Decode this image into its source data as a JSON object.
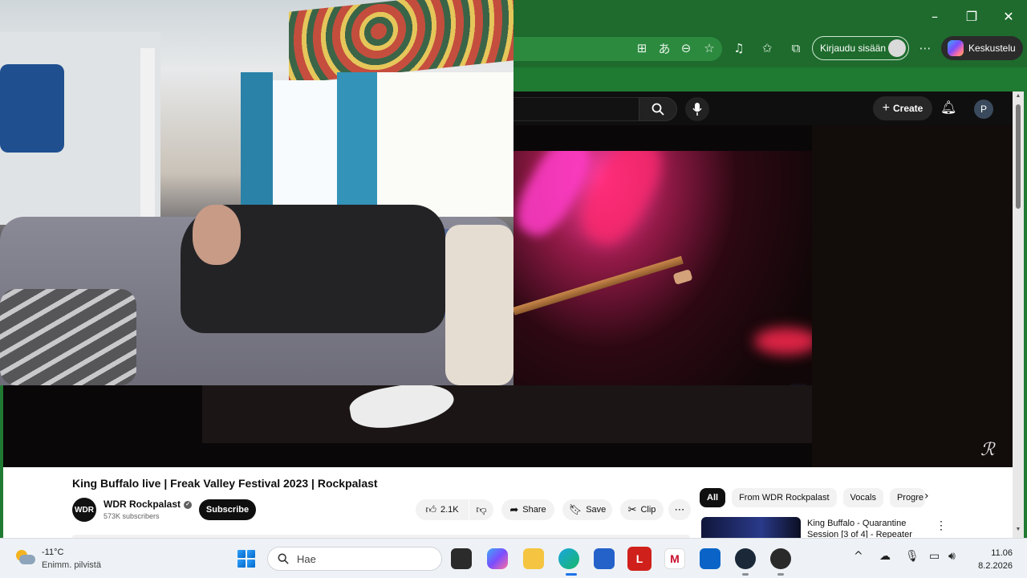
{
  "browser": {
    "window_controls": {
      "minimize": "–",
      "restore": "❐",
      "close": "✕"
    },
    "signin_label": "Kirjaudu sisään",
    "copilot_label": "Keskustelu",
    "toolbar_icons": [
      "apps-icon",
      "translate-icon",
      "zoom-out-icon",
      "favorite-star-icon",
      "read-aloud-icon",
      "favorites-icon",
      "collections-icon",
      "more-icon"
    ]
  },
  "youtube": {
    "create_label": "Create",
    "avatar_letter": "P",
    "video": {
      "title": "King Buffalo live | Freak Valley Festival 2023 | Rockpalast",
      "watermark": "ℛ",
      "channel_initials": "WDR",
      "channel_name": "WDR Rockpalast",
      "subscribers": "573K subscribers",
      "subscribe_label": "Subscribe",
      "likes": "2.1K",
      "share_label": "Share",
      "save_label": "Save",
      "clip_label": "Clip"
    },
    "chips": [
      "All",
      "From WDR Rockpalast",
      "Vocals",
      "Progre"
    ],
    "recommendation": {
      "title": "King Buffalo - Quarantine Session [3 of 4] - Repeater"
    }
  },
  "taskbar": {
    "temperature": "-11°C",
    "condition": "Enimm. pilvistä",
    "search_placeholder": "Hae",
    "time": "11.06",
    "date": "8.2.2026"
  }
}
